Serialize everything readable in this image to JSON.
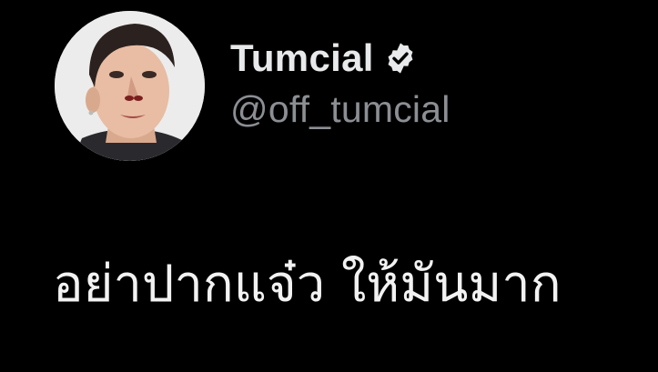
{
  "author": {
    "display_name": "Tumcial",
    "handle": "@off_tumcial",
    "verified": true,
    "avatar_icon": "profile-photo",
    "verified_icon": "verified-badge-icon"
  },
  "tweet": {
    "text": "อย่าปากแจ๋ว ให้มันมาก"
  },
  "colors": {
    "background": "#000000",
    "name": "#e7e9ea",
    "handle": "#8b8f94",
    "text": "#f2f2f2"
  }
}
